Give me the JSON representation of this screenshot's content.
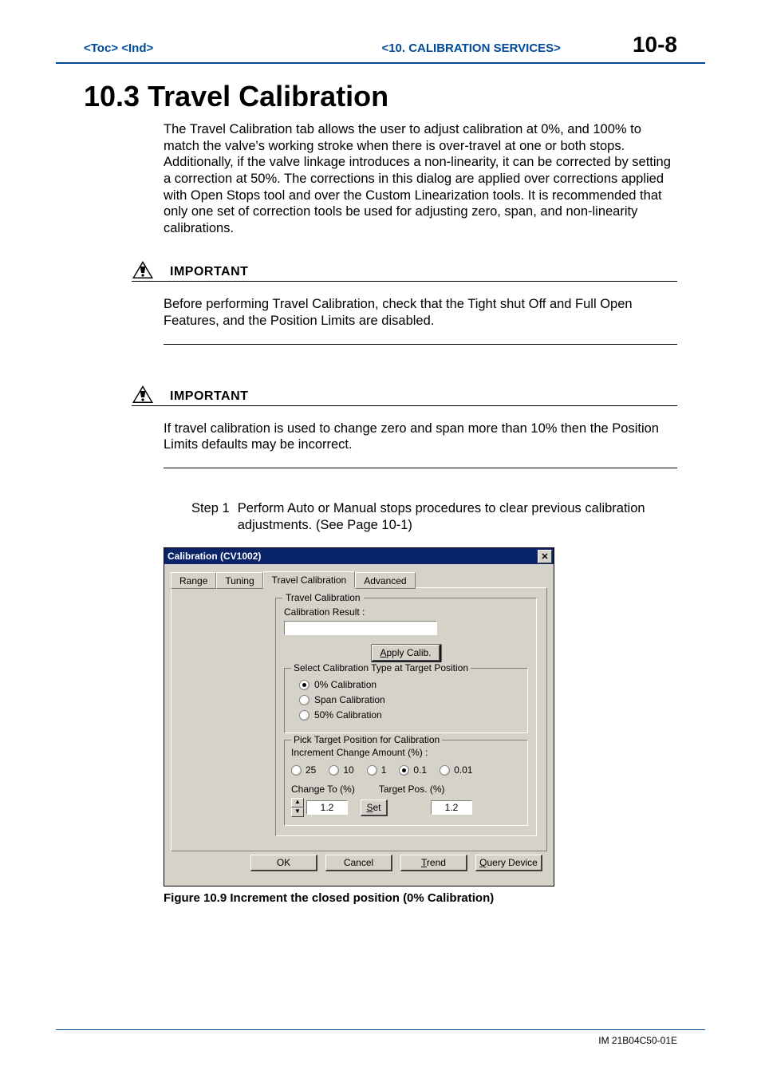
{
  "header": {
    "toc": "<Toc>",
    "ind": "<Ind>",
    "chapter": "<10.  CALIBRATION SERVICES>",
    "pagenum": "10-8"
  },
  "section_title": "10.3  Travel Calibration",
  "intro_para": "The Travel Calibration tab allows the user to adjust calibration at 0%, and 100% to match the valve's working stroke when there is over-travel at one or both stops.  Additionally, if the valve linkage introduces a non-linearity, it can be corrected by setting a correction at 50%. The corrections in this dialog are applied over corrections applied with Open Stops tool and over the Custom Linearization tools.  It is recommended that only one set of correction tools be used for adjusting zero, span, and non-linearity calibrations.",
  "important_label": "IMPORTANT",
  "important1_text": "Before performing Travel Calibration, check that the Tight shut Off and Full Open Features, and the Position Limits are disabled.",
  "important2_text": "If travel calibration is used to change zero and span more than 10% then the Position Limits defaults may be incorrect.",
  "step1_label": "Step 1",
  "step1_text": "Perform Auto or Manual stops procedures to clear previous calibration adjustments. (See Page 10-1)",
  "dialog": {
    "title": "Calibration (CV1002)",
    "tabs": {
      "range": "Range",
      "tuning": "Tuning",
      "travel": "Travel Calibration",
      "advanced": "Advanced"
    },
    "group_travel": "Travel Calibration",
    "cal_result_label": "Calibration Result :",
    "cal_result_value": "",
    "apply_btn": "Apply Calib.",
    "group_select": "Select Calibration Type at Target Position",
    "opt_0": "0% Calibration",
    "opt_span": "Span Calibration",
    "opt_50": "50% Calibration",
    "group_pick": "Pick Target Position for Calibration",
    "incr_label": "Increment Change Amount (%) :",
    "incr_opts": {
      "o25": "25",
      "o10": "10",
      "o1": "1",
      "o01": "0.1",
      "o001": "0.01"
    },
    "change_to_label": "Change To (%)",
    "target_pos_label": "Target Pos. (%)",
    "change_to_value": "1.2",
    "set_btn": "Set",
    "target_pos_value": "1.2",
    "btn_ok": "OK",
    "btn_cancel": "Cancel",
    "btn_trend": "Trend",
    "btn_query": "Query Device"
  },
  "figure_caption": "Figure 10.9 Increment the closed position (0% Calibration)",
  "footer": "IM 21B04C50-01E"
}
